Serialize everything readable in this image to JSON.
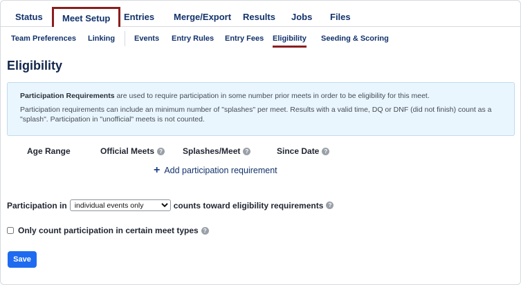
{
  "top_tabs": [
    "Status",
    "Meet Setup",
    "Entries",
    "Merge/Export",
    "Results",
    "Jobs",
    "Files"
  ],
  "sub_tabs": [
    "Team Preferences",
    "Linking",
    "Events",
    "Entry Rules",
    "Entry Fees",
    "Eligibility",
    "Seeding & Scoring"
  ],
  "page_title": "Eligibility",
  "info": {
    "bold": "Participation Requirements",
    "p1_rest": " are used to require participation in some number prior meets in order to be eligibility for this meet.",
    "p2": "Participation requirements can include an minimum number of \"splashes\" per meet. Results with a valid time, DQ or DNF (did not finish) count as a \"splash\". Participation in \"unofficial\" meets is not counted."
  },
  "columns": {
    "age_range": "Age Range",
    "official_meets": "Official Meets",
    "splashes_per_meet": "Splashes/Meet",
    "since_date": "Since Date"
  },
  "add_requirement": "Add participation requirement",
  "participation": {
    "prefix": "Participation in",
    "selected": "individual events only",
    "suffix": "counts toward eligibility requirements"
  },
  "only_count_label": "Only count participation in certain meet types",
  "save_label": "Save",
  "help_glyph": "?",
  "colors": {
    "accent": "#8b1d1d",
    "primary": "#1f6bf0",
    "info_bg": "#eaf6fd"
  }
}
